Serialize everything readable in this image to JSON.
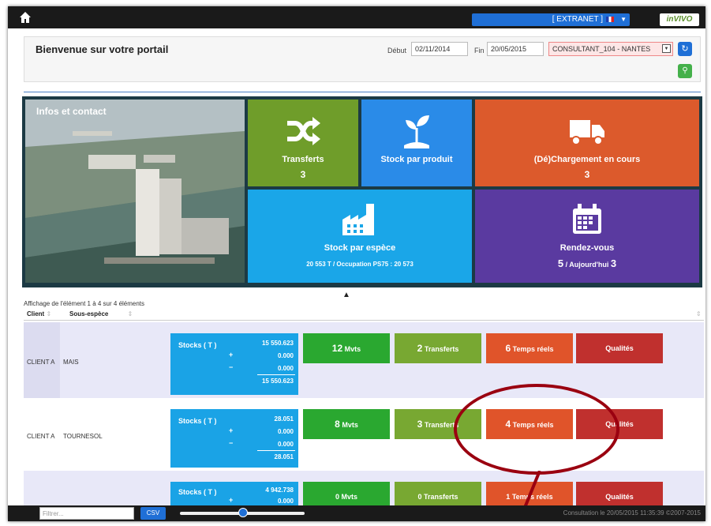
{
  "topbar": {
    "extranet": "[ EXTRANET ]",
    "brand": "inVIVO"
  },
  "header": {
    "welcome": "Bienvenue sur votre portail",
    "debut_label": "Début",
    "debut_value": "02/11/2014",
    "fin_label": "Fin",
    "fin_value": "20/05/2015",
    "consultant": "CONSULTANT_104 - NANTES"
  },
  "tiles": {
    "info": "Infos et contact",
    "transferts": {
      "label": "Transferts",
      "value": "3"
    },
    "stock_produit": {
      "label": "Stock par produit"
    },
    "chargement": {
      "label": "(Dé)Chargement en cours",
      "value": "3"
    },
    "stock_espece": {
      "label": "Stock par espèce",
      "value": "20 553 T / Occupation PS75 : 20 573"
    },
    "rdv": {
      "label": "Rendez-vous",
      "value_pre": "5",
      "value_mid": " / Aujourd'hui ",
      "value_post": "3"
    }
  },
  "colors": {
    "transferts": "#6f9d2a",
    "stock_produit": "#2a8be8",
    "chargement": "#dc5a2c",
    "stock_espece": "#1aa6e8",
    "rdv": "#5a3aa0"
  },
  "table": {
    "showing": "Affichage de l'élément 1 à 4 sur 4 éléments",
    "col_client": "Client",
    "col_species": "Sous-espèce",
    "rows": [
      {
        "client": "CLIENT A",
        "species": "MAIS",
        "stocks_label": "Stocks ( T )",
        "v1": "15 550.623",
        "v2": "0.000",
        "v3": "0.000",
        "total": "15 550.623",
        "mvts_n": "12",
        "mvts": "Mvts",
        "transf_n": "2",
        "transf": "Transferts",
        "tr_n": "6",
        "tr": "Temps réels",
        "qual": "Qualités"
      },
      {
        "client": "CLIENT A",
        "species": "TOURNESOL",
        "stocks_label": "Stocks ( T )",
        "v1": "28.051",
        "v2": "0.000",
        "v3": "0.000",
        "total": "28.051",
        "mvts_n": "8",
        "mvts": "Mvts",
        "transf_n": "3",
        "transf": "Transferts",
        "tr_n": "4",
        "tr": "Temps réels",
        "qual": "Qualités"
      },
      {
        "stocks_label": "Stocks ( T )",
        "v1": "4 942.738",
        "v2": "0.000",
        "mvts_n": "0",
        "mvts": "Mvts",
        "transf_n": "0",
        "transf": "Transferts",
        "tr_n": "1",
        "tr": "Temps réels",
        "qual": "Qualités"
      }
    ]
  },
  "footer": {
    "filter_placeholder": "Filtrer...",
    "csv": "CSV",
    "consultation": "Consultation le 20/05/2015 11:35:39 ©2007-2015"
  }
}
